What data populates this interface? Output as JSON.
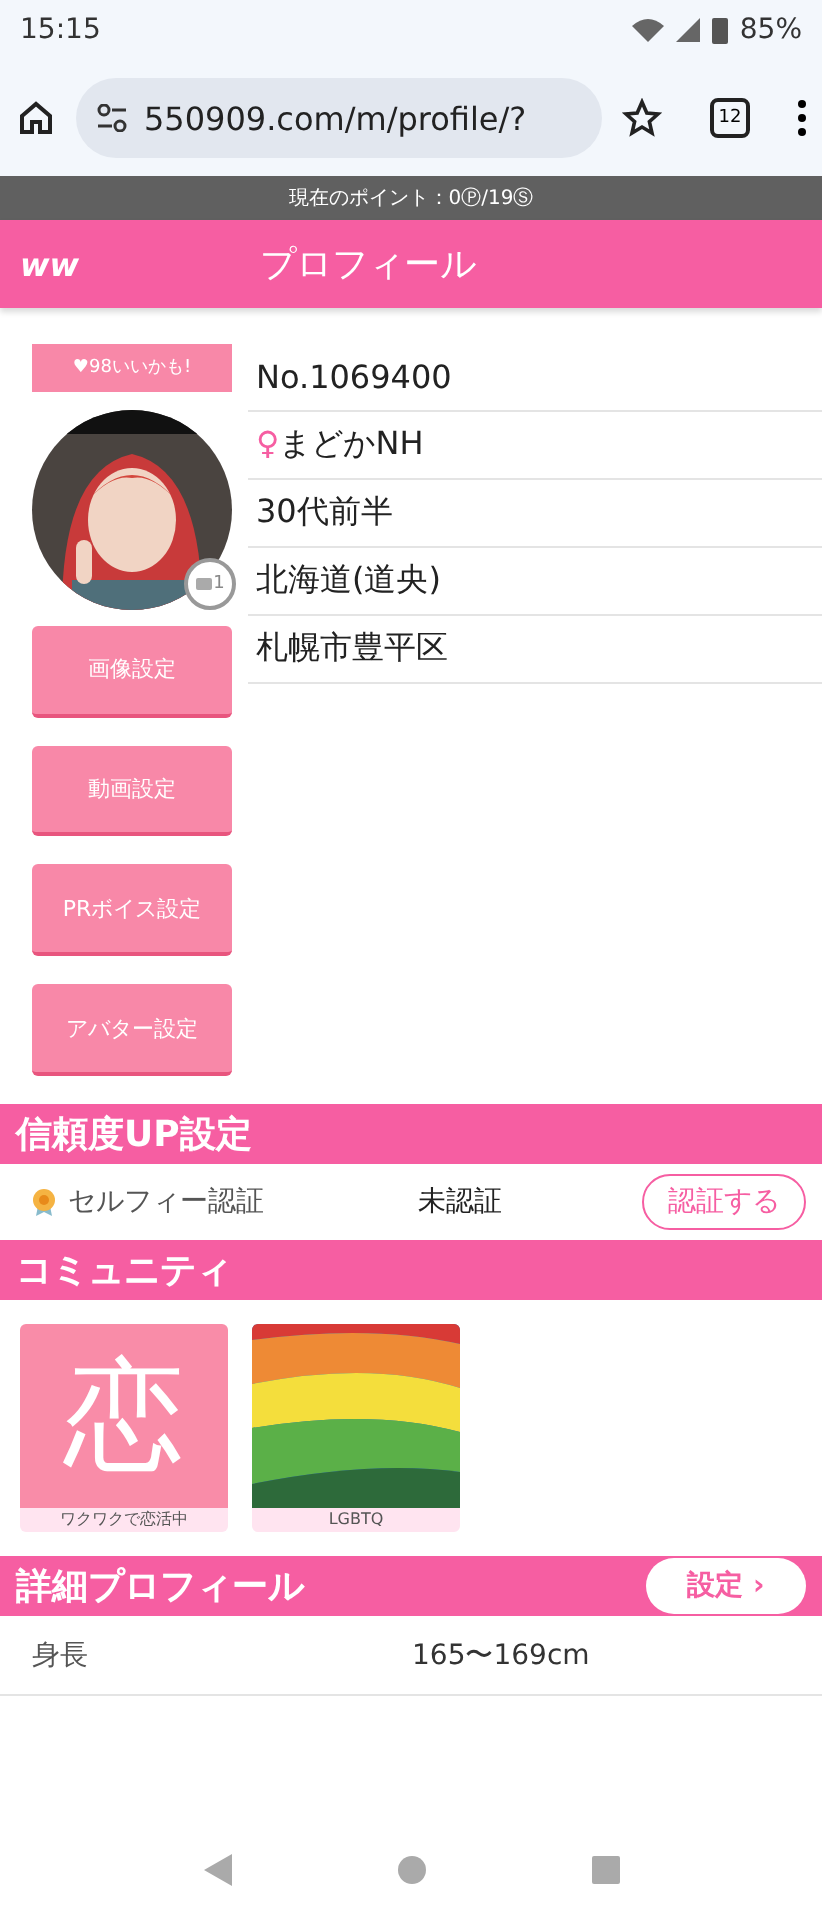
{
  "status_bar": {
    "time": "15:15",
    "battery": "85%"
  },
  "browser": {
    "url": "550909.com/m/profile/?",
    "tabs_count": "12"
  },
  "points_bar": {
    "text": "現在のポイント：0Ⓟ/19Ⓢ"
  },
  "header": {
    "logo": "ww",
    "title": "プロフィール"
  },
  "profile": {
    "likes": "♥98いいかも!",
    "photo_count": "1",
    "fields": [
      {
        "kind": "plain",
        "text": "No.1069400"
      },
      {
        "kind": "female",
        "text": "まどかNH",
        "symbol": "♀"
      },
      {
        "kind": "plain",
        "text": "30代前半"
      },
      {
        "kind": "plain",
        "text": "北海道(道央)"
      },
      {
        "kind": "plain",
        "text": "札幌市豊平区"
      }
    ],
    "buttons": [
      "画像設定",
      "動画設定",
      "PRボイス設定",
      "アバター設定"
    ]
  },
  "trust": {
    "title": "信頼度UP設定",
    "item": {
      "label": "セルフィー認証",
      "status": "未認証",
      "action": "認証する"
    }
  },
  "community": {
    "title": "コミュニティ",
    "items": [
      {
        "kind": "love",
        "glyph": "恋",
        "caption": "ワクワクで恋活中"
      },
      {
        "kind": "picture",
        "caption": "LGBTQ"
      }
    ]
  },
  "details": {
    "title": "詳細プロフィール",
    "button": "設定",
    "chevron": "›",
    "rows": [
      {
        "label": "身長",
        "value": "165〜169cm"
      }
    ]
  }
}
